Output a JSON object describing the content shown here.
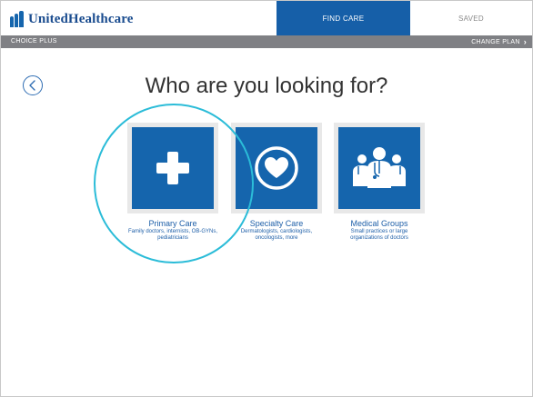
{
  "header": {
    "brand": "UnitedHealthcare",
    "tabs": {
      "find_care": "FIND CARE",
      "saved": "SAVED"
    }
  },
  "plan_bar": {
    "plan_name": "CHOICE PLUS",
    "change_plan": "CHANGE PLAN",
    "chevron": "›"
  },
  "main": {
    "title": "Who are you looking for?",
    "cards": [
      {
        "title": "Primary Care",
        "description": "Family doctors, internists, OB-GYNs, pediatricians",
        "icon": "plus-icon"
      },
      {
        "title": "Specialty Care",
        "description": "Dermatologists, cardiologists, oncologists, more",
        "icon": "heart-icon"
      },
      {
        "title": "Medical Groups",
        "description": "Small practices or large organizations of doctors",
        "icon": "doctors-group-icon"
      }
    ]
  },
  "colors": {
    "brand_blue": "#1565ad",
    "highlight": "#2bbcd8",
    "plan_bar": "#7f8084"
  }
}
